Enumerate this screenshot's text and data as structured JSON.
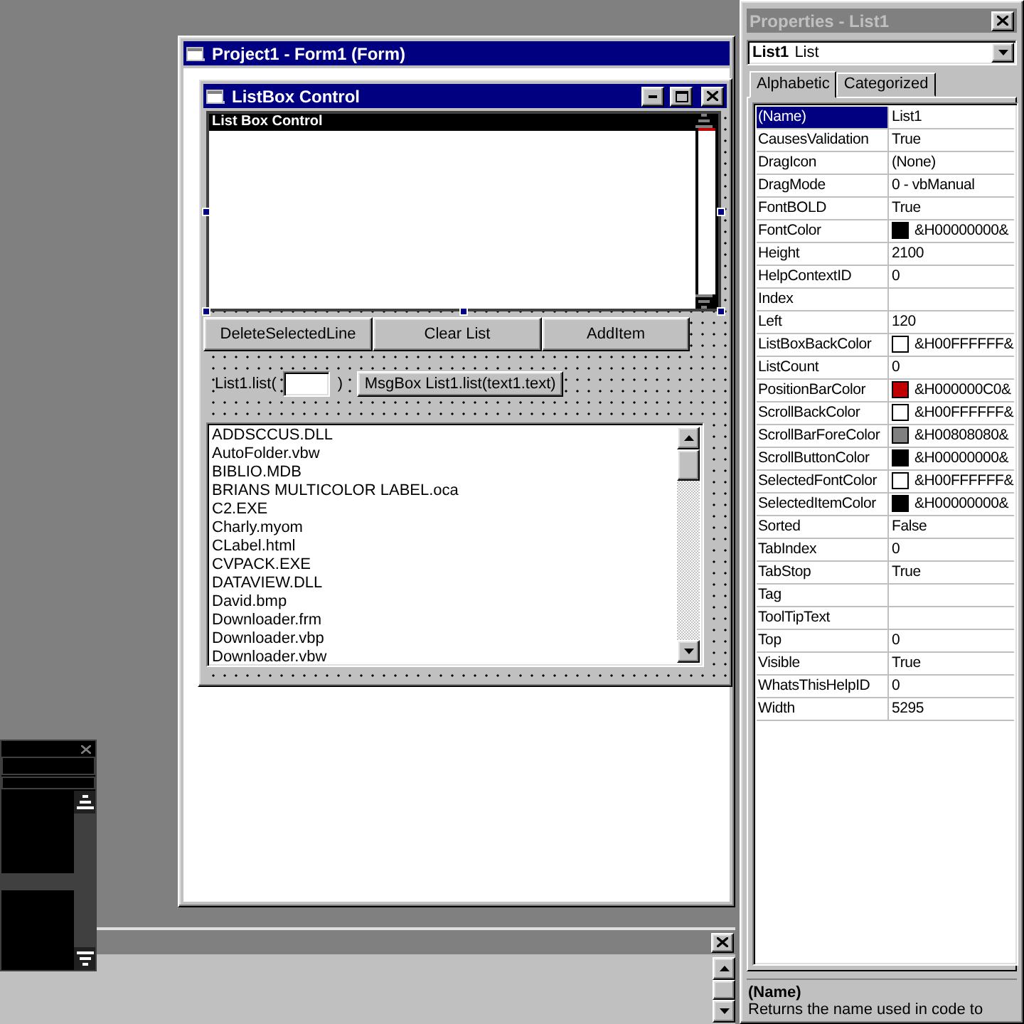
{
  "designer": {
    "title": "Project1 - Form1 (Form)"
  },
  "form": {
    "title": "ListBox Control",
    "listbox_header": "List Box Control",
    "buttons": [
      "DeleteSelectedLine",
      "Clear List",
      "AddItem"
    ],
    "index_label": "List1.list(",
    "index_close": ")",
    "msgbox_button": "MsgBox List1.list(text1.text)",
    "files": [
      "ADDSCCUS.DLL",
      "AutoFolder.vbw",
      "BIBLIO.MDB",
      "BRIANS MULTICOLOR LABEL.oca",
      "C2.EXE",
      "Charly.myom",
      "CLabel.html",
      "CVPACK.EXE",
      "DATAVIEW.DLL",
      "David.bmp",
      "Downloader.frm",
      "Downloader.vbp",
      "Downloader.vbw"
    ]
  },
  "properties": {
    "title": "Properties - List1",
    "object": {
      "name": "List1",
      "type": "List"
    },
    "tabs": [
      {
        "label": "Alphabetic",
        "selected": true
      },
      {
        "label": "Categorized",
        "selected": false
      }
    ],
    "rows": [
      {
        "name": "(Name)",
        "value": "List1",
        "selected": true
      },
      {
        "name": "CausesValidation",
        "value": "True",
        "selected": false
      },
      {
        "name": "DragIcon",
        "value": "(None)",
        "selected": false
      },
      {
        "name": "DragMode",
        "value": "0 - vbManual",
        "selected": false
      },
      {
        "name": "FontBOLD",
        "value": "True",
        "selected": false
      },
      {
        "name": "FontColor",
        "value": "&H00000000&",
        "color": "#000000",
        "selected": false
      },
      {
        "name": "Height",
        "value": "2100",
        "selected": false
      },
      {
        "name": "HelpContextID",
        "value": "0",
        "selected": false
      },
      {
        "name": "Index",
        "selected": false
      },
      {
        "name": "Left",
        "value": "120",
        "selected": false
      },
      {
        "name": "ListBoxBackColor",
        "value": "&H00FFFFFF&",
        "color": "#ffffff",
        "selected": false
      },
      {
        "name": "ListCount",
        "value": "0",
        "selected": false
      },
      {
        "name": "PositionBarColor",
        "value": "&H000000C0&",
        "color": "#c00000",
        "selected": false
      },
      {
        "name": "ScrollBackColor",
        "value": "&H00FFFFFF&",
        "color": "#ffffff",
        "selected": false
      },
      {
        "name": "ScrollBarForeColor",
        "value": "&H00808080&",
        "color": "#808080",
        "selected": false
      },
      {
        "name": "ScrollButtonColor",
        "value": "&H00000000&",
        "color": "#000000",
        "selected": false
      },
      {
        "name": "SelectedFontColor",
        "value": "&H00FFFFFF&",
        "color": "#ffffff",
        "selected": false
      },
      {
        "name": "SelectedItemColor",
        "value": "&H00000000&",
        "color": "#000000",
        "selected": false
      },
      {
        "name": "Sorted",
        "value": "False",
        "selected": false
      },
      {
        "name": "TabIndex",
        "value": "0",
        "selected": false
      },
      {
        "name": "TabStop",
        "value": "True",
        "selected": false
      },
      {
        "name": "Tag",
        "selected": false
      },
      {
        "name": "ToolTipText",
        "selected": false
      },
      {
        "name": "Top",
        "value": "0",
        "selected": false
      },
      {
        "name": "Visible",
        "value": "True",
        "selected": false
      },
      {
        "name": "WhatsThisHelpID",
        "value": "0",
        "selected": false
      },
      {
        "name": "Width",
        "value": "5295",
        "selected": false
      }
    ],
    "description": {
      "title": "(Name)",
      "text": "Returns the name used in code to"
    }
  }
}
